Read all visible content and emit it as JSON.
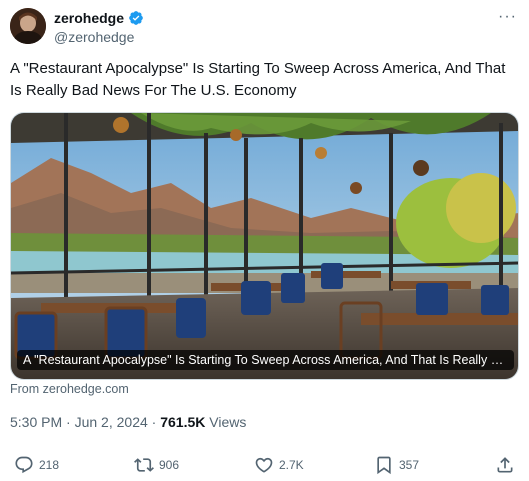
{
  "author": {
    "display_name": "zerohedge",
    "handle": "@zerohedge",
    "verified_color": "#1d9bf0"
  },
  "more_menu": "···",
  "tweet": {
    "text": "A \"Restaurant Apocalypse\" Is Starting To Sweep Across America, And That Is Really Bad News For The U.S. Economy"
  },
  "card": {
    "overlay_title": "A \"Restaurant Apocalypse\" Is Starting To Sweep Across America, And That Is Really Bad...",
    "source": "From zerohedge.com"
  },
  "meta": {
    "time": "5:30 PM",
    "separator": "·",
    "date": "Jun 2, 2024",
    "views_count": "761.5K",
    "views_label": "Views"
  },
  "actions": {
    "replies": "218",
    "reposts": "906",
    "likes": "2.7K",
    "bookmarks": "357"
  },
  "icons": {
    "reply": "reply-icon",
    "repost": "repost-icon",
    "like": "heart-icon",
    "bookmark": "bookmark-icon",
    "share": "share-icon",
    "verified": "verified-badge-icon"
  }
}
